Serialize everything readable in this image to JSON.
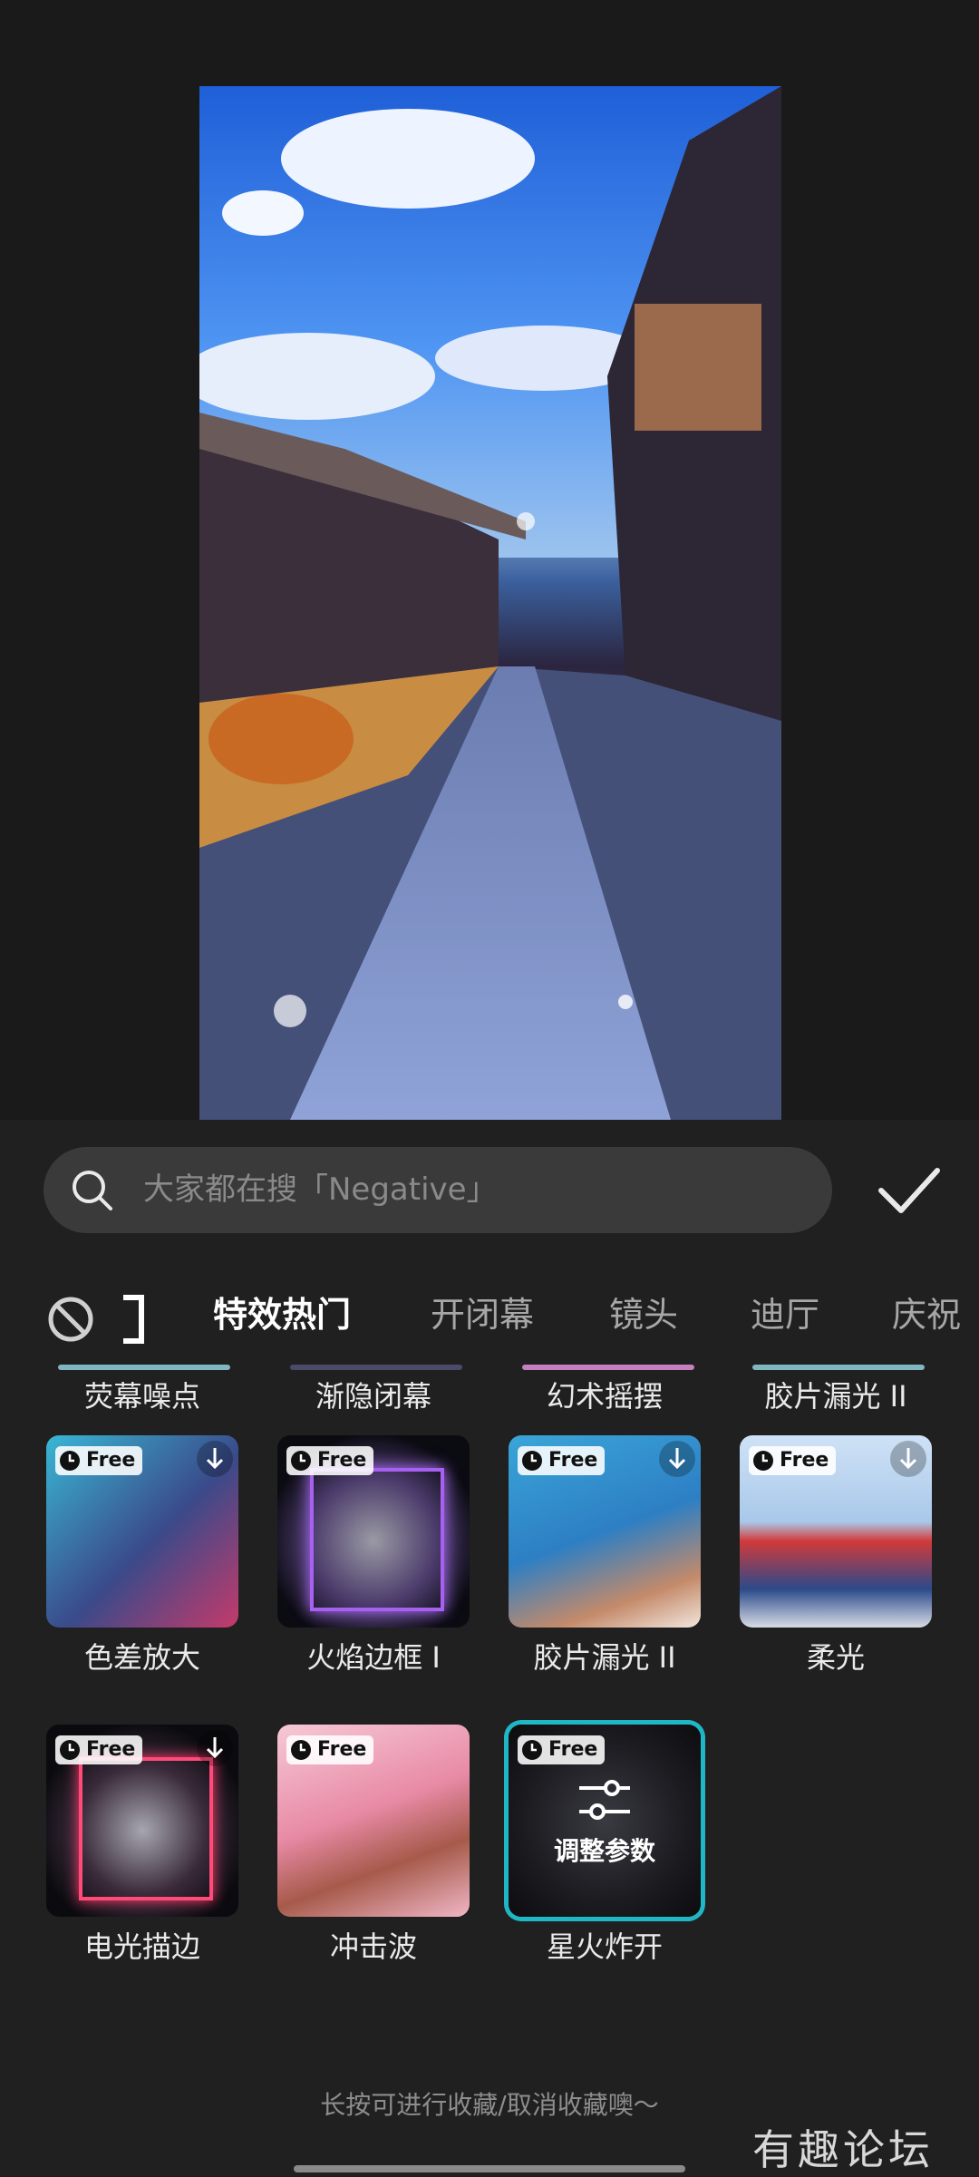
{
  "search": {
    "placeholder": "大家都在搜「Negative」"
  },
  "tabs": [
    "特效热门",
    "开闭幕",
    "镜头",
    "迪厅",
    "庆祝"
  ],
  "active_tab": 0,
  "previous_row_labels": [
    "荧幕噪点",
    "渐隐闭幕",
    "幻术摇摆",
    "胶片漏光 II"
  ],
  "effects": [
    {
      "label": "色差放大",
      "badge": "Free",
      "download": true
    },
    {
      "label": "火焰边框 I",
      "badge": "Free",
      "download": false
    },
    {
      "label": "胶片漏光 II",
      "badge": "Free",
      "download": true
    },
    {
      "label": "柔光",
      "badge": "Free",
      "download": true
    },
    {
      "label": "电光描边",
      "badge": "Free",
      "download": true
    },
    {
      "label": "冲击波",
      "badge": "Free",
      "download": false
    },
    {
      "label": "星火炸开",
      "badge": "Free",
      "download": false,
      "selected": true,
      "overlay": "调整参数"
    }
  ],
  "hint": "长按可进行收藏/取消收藏噢～",
  "watermark": "有趣论坛",
  "colors": {
    "accent": "#1fb6c6",
    "panel": "#202020",
    "search_bg": "#3a3a3a"
  }
}
